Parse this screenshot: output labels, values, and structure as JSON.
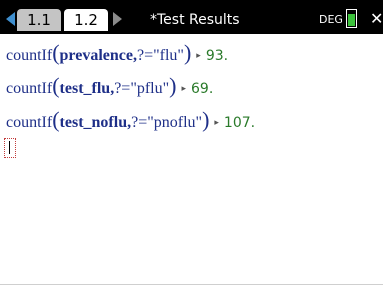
{
  "tabs": [
    {
      "label": "1.1"
    },
    {
      "label": "1.2"
    }
  ],
  "document_title": "*Test Results",
  "angle_mode": "DEG",
  "history": [
    {
      "func": "countIf",
      "arg": "prevalence,",
      "cond": "?=\"flu\"",
      "result": "93."
    },
    {
      "func": "countIf",
      "arg": "test_flu,",
      "cond": "?=\"pflu\"",
      "result": "69."
    },
    {
      "func": "countIf",
      "arg": "test_noflu,",
      "cond": "?=\"pnoflu\"",
      "result": "107."
    }
  ],
  "icons": {
    "prev_page": "left-arrow-icon",
    "next_page": "right-arrow-icon",
    "battery": "battery-icon",
    "close": "close-icon",
    "result_marker": "right-triangle-icon"
  },
  "colors": {
    "topbar": "#000000",
    "active_tab": "#ffffff",
    "inactive_tab": "#c4c4c4",
    "expression": "#1e2f88",
    "result": "#2a7a2a",
    "battery": "#3cc23c",
    "cursor_box": "#c23b3b"
  }
}
